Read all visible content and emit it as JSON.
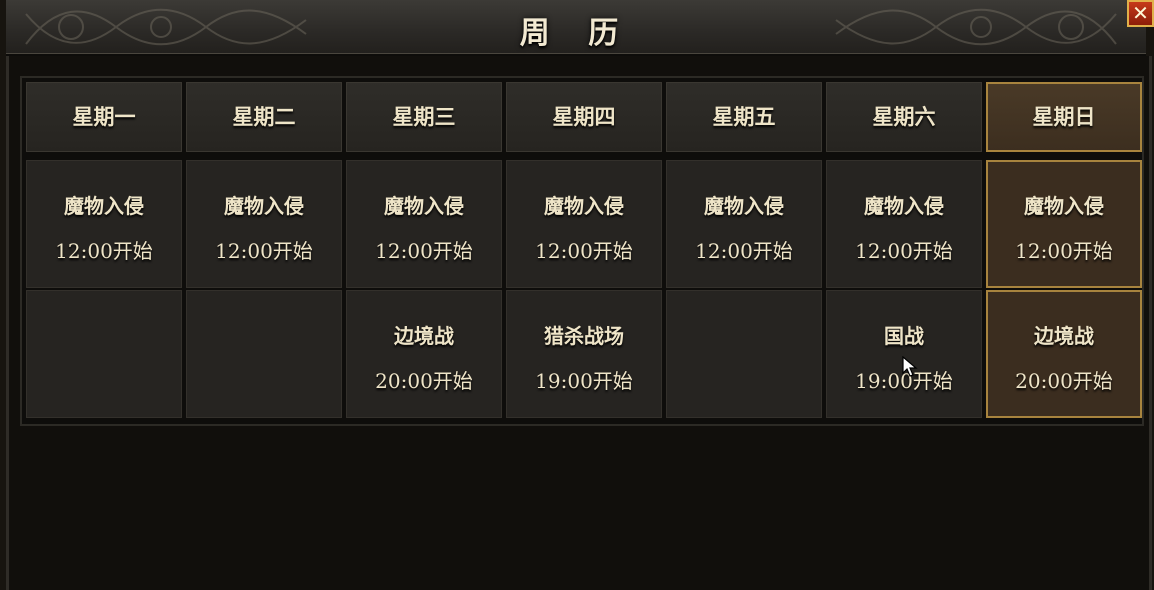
{
  "window": {
    "title": "周 历",
    "close_label": "✕"
  },
  "calendar": {
    "days": [
      {
        "label": "星期一",
        "active": false
      },
      {
        "label": "星期二",
        "active": false
      },
      {
        "label": "星期三",
        "active": false
      },
      {
        "label": "星期四",
        "active": false
      },
      {
        "label": "星期五",
        "active": false
      },
      {
        "label": "星期六",
        "active": false
      },
      {
        "label": "星期日",
        "active": true
      }
    ],
    "row1": [
      {
        "name": "魔物入侵",
        "time": "12:00开始"
      },
      {
        "name": "魔物入侵",
        "time": "12:00开始"
      },
      {
        "name": "魔物入侵",
        "time": "12:00开始"
      },
      {
        "name": "魔物入侵",
        "time": "12:00开始"
      },
      {
        "name": "魔物入侵",
        "time": "12:00开始"
      },
      {
        "name": "魔物入侵",
        "time": "12:00开始"
      },
      {
        "name": "魔物入侵",
        "time": "12:00开始"
      }
    ],
    "row2": [
      {
        "name": "",
        "time": ""
      },
      {
        "name": "",
        "time": ""
      },
      {
        "name": "边境战",
        "time": "20:00开始"
      },
      {
        "name": "猎杀战场",
        "time": "19:00开始"
      },
      {
        "name": "",
        "time": ""
      },
      {
        "name": "国战",
        "time": "19:00开始"
      },
      {
        "name": "边境战",
        "time": "20:00开始"
      }
    ]
  },
  "colors": {
    "text": "#efe5c8",
    "active_border": "#a8843e",
    "close_bg": "#c63a1a"
  }
}
